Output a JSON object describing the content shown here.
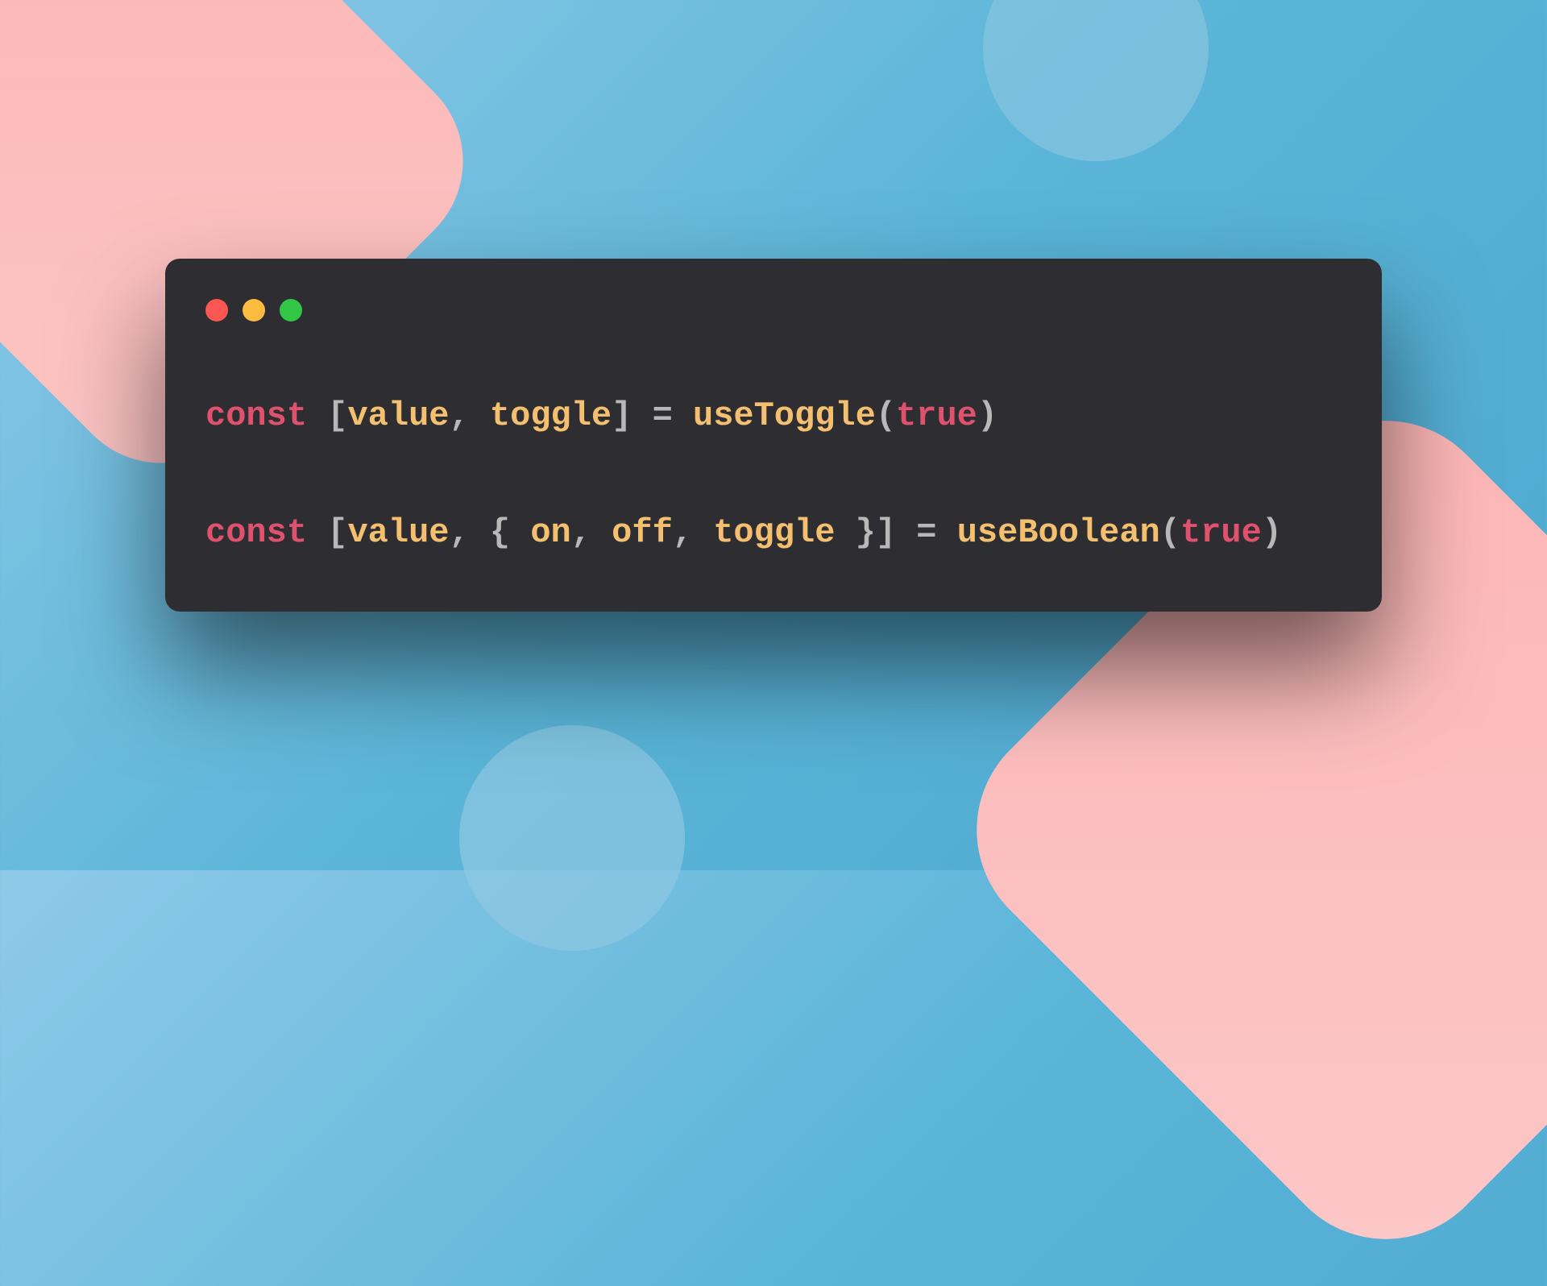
{
  "window": {
    "traffic_lights": {
      "red": "#fc5753",
      "yellow": "#fdbc40",
      "green": "#33c748"
    }
  },
  "code": {
    "line1": {
      "keyword": "const",
      "bracket_open": " [",
      "var1": "value",
      "comma1": ", ",
      "var2": "toggle",
      "bracket_close": "]",
      "equals": " = ",
      "func": "useToggle",
      "paren_open": "(",
      "arg": "true",
      "paren_close": ")"
    },
    "line2": {
      "keyword": "const",
      "bracket_open": " [",
      "var1": "value",
      "comma1": ", ",
      "brace_open": "{ ",
      "var2": "on",
      "comma2": ", ",
      "var3": "off",
      "comma3": ", ",
      "var4": "toggle",
      "brace_close": " }",
      "bracket_close": "]",
      "equals": " = ",
      "func": "useBoolean",
      "paren_open": "(",
      "arg": "true",
      "paren_close": ")"
    }
  }
}
